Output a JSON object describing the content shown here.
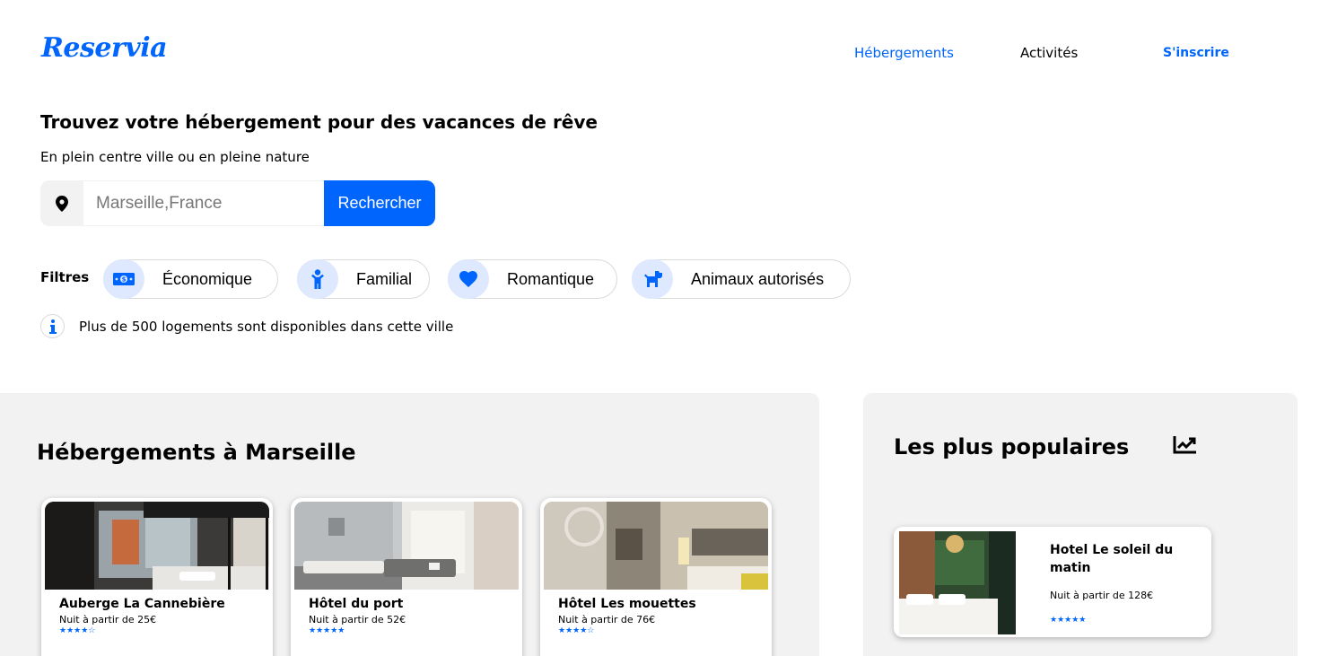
{
  "header": {
    "logo": "Reservia",
    "nav": {
      "hebergements": "Hébergements",
      "activites": "Activités",
      "inscrire": "S'inscrire"
    }
  },
  "hero": {
    "title": "Trouvez votre hébergement pour des vacances de rêve",
    "subtitle": "En plein centre ville ou en pleine nature",
    "search": {
      "placeholder": "Marseille,France",
      "button": "Rechercher"
    }
  },
  "filters": {
    "label": "Filtres",
    "items": [
      {
        "label": "Économique",
        "icon": "money-bill-icon"
      },
      {
        "label": "Familial",
        "icon": "child-icon"
      },
      {
        "label": "Romantique",
        "icon": "heart-icon"
      },
      {
        "label": "Animaux autorisés",
        "icon": "dog-icon"
      }
    ]
  },
  "info": {
    "text": "Plus de 500 logements sont disponibles dans cette ville"
  },
  "hebergements": {
    "title": "Hébergements à Marseille",
    "cards": [
      {
        "name": "Auberge La Cannebière",
        "price": "Nuit à partir de 25€",
        "rating": 4,
        "stars": "★★★★☆"
      },
      {
        "name": "Hôtel du port",
        "price": "Nuit à partir de 52€",
        "rating": 5,
        "stars": "★★★★★"
      },
      {
        "name": "Hôtel Les mouettes",
        "price": "Nuit à partir de 76€",
        "rating": 4,
        "stars": "★★★★☆"
      }
    ]
  },
  "populaires": {
    "title": "Les plus populaires",
    "cards": [
      {
        "name": "Hotel Le soleil du matin",
        "price": "Nuit à partir de 128€",
        "rating": 5,
        "stars": "★★★★★"
      }
    ]
  },
  "colors": {
    "accent": "#0065fc",
    "panel": "#f2f2f2",
    "filter_icon_bg": "#dee9ff"
  }
}
